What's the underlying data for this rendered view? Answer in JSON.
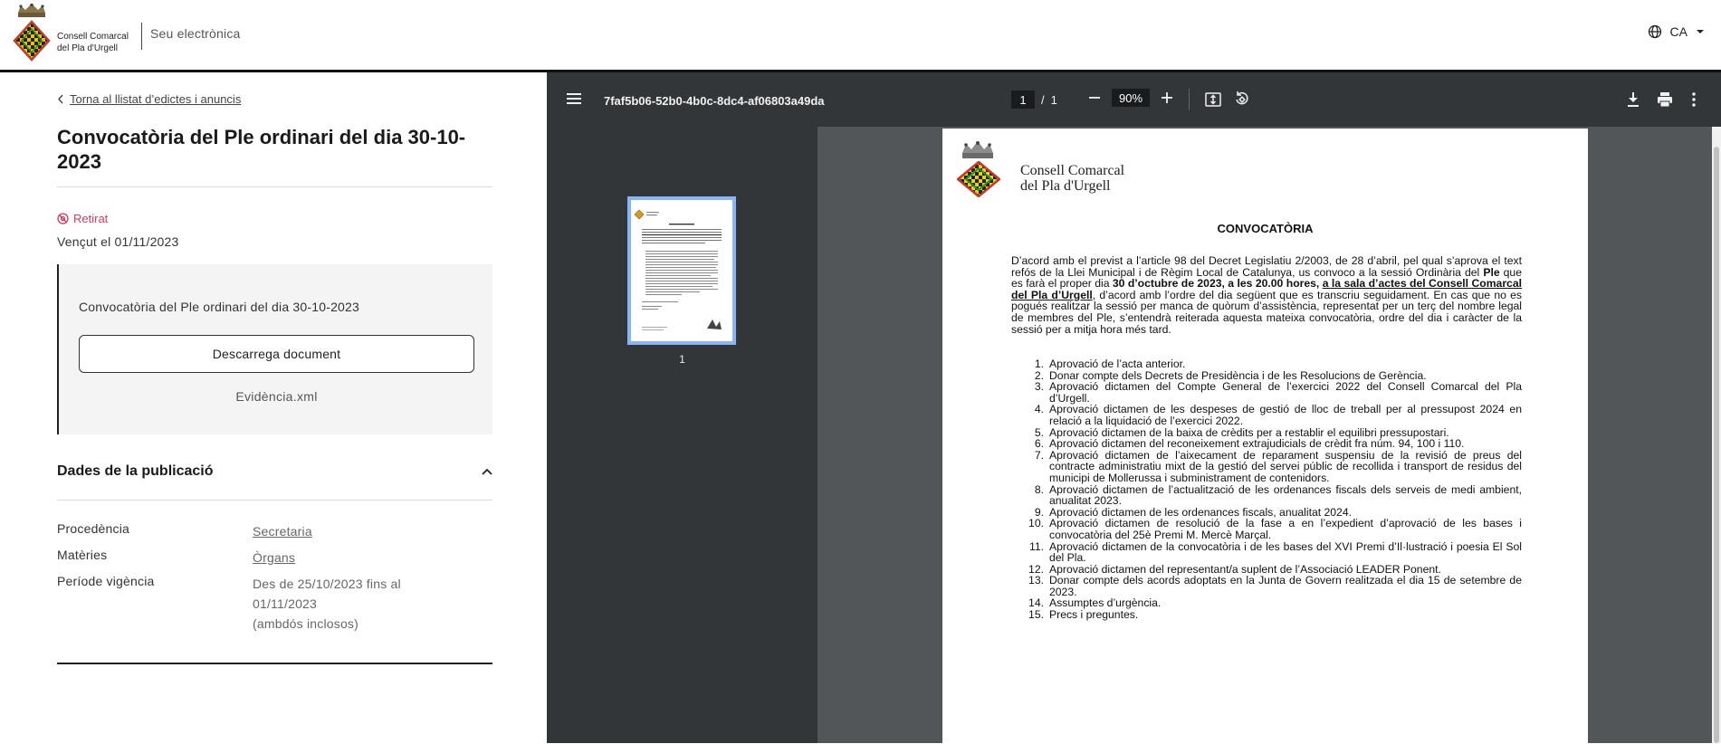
{
  "header": {
    "brand_line1": "Consell Comarcal",
    "brand_line2": "del Pla d'Urgell",
    "seu": "Seu electrònica",
    "language": "CA"
  },
  "left": {
    "back_link": "Torna al llistat d’edictes i anuncis",
    "title": "Convocatòria del Ple ordinari del dia 30-10-2023",
    "status": "Retirat",
    "expired": "Vençut el 01/11/2023",
    "document_box": {
      "title": "Convocatòria del Ple ordinari del dia 30-10-2023",
      "download_label": "Descarrega document",
      "evidence": "Evidència.xml"
    },
    "publication": {
      "heading": "Dades de la publicació",
      "rows": [
        {
          "label": "Procedència",
          "value": "Secretaria"
        },
        {
          "label": "Matèries",
          "value": "Òrgans"
        },
        {
          "label": "Període vigència",
          "value_line1": "Des de 25/10/2023 fins al",
          "value_line2": "01/11/2023",
          "value_line3": "(ambdós inclosos)"
        }
      ]
    }
  },
  "viewer": {
    "filename": "7faf5b06-52b0-4b0c-8dc4-af06803a49da",
    "page_current": "1",
    "page_total": "1",
    "zoom": "90%",
    "thumb_label": "1",
    "pdf": {
      "brand_line1": "Consell Comarcal",
      "brand_line2": "del Pla d'Urgell",
      "heading": "CONVOCATÒRIA",
      "para_part1": "D’acord amb el previst a l’article 98 del Decret Legislatiu 2/2003, de 28 d’abril, pel qual s’aprova el text refós de la Llei Municipal i de Règim Local de Catalunya, us convoco a la sessió Ordinària del ",
      "para_bold1": "Ple",
      "para_part2": " que es farà el proper dia ",
      "para_bold2": "30 d’octubre de 2023, a les 20.00 hores, ",
      "para_underline": "a la sala d’actes del Consell Comarcal del Pla d’Urgell",
      "para_part3": ", d’acord amb l’ordre del dia següent que es transcriu seguidament. En cas que no es pogués realitzar la sessió per manca de quòrum d’assistència, representat per un terç del nombre legal de membres del Ple, s’entendrà reiterada aquesta mateixa convocatòria, ordre del dia i caràcter de la sessió per a mitja hora més tard.",
      "items": [
        "Aprovació de l’acta anterior.",
        "Donar compte dels Decrets de Presidència i de les Resolucions de Gerència.",
        "Aprovació dictamen del Compte General de l’exercici 2022 del Consell Comarcal del Pla d’Urgell.",
        "Aprovació dictamen de les despeses de gestió de lloc de treball per al pressupost 2024 en relació a la liquidació de l’exercici 2022.",
        "Aprovació dictamen de la baixa de crèdits per a restablir el equilibri pressupostari.",
        "Aprovació dictamen del  reconeixement extrajudicials de crèdit fra núm. 94, 100 i 110.",
        "Aprovació dictamen de l’aixecament de reparament suspensiu de la revisió de preus del contracte administratiu mixt de la gestió del servei públic de recollida i transport de residus del municipi de Mollerussa i subministrament de contenidors.",
        "Aprovació dictamen de l’actualització de les ordenances fiscals dels serveis de medi ambient, anualitat 2023.",
        "Aprovació dictamen de les ordenances fiscals, anualitat 2024.",
        "Aprovació dictamen de resolució de la fase a en l’expedient d’aprovació de les bases i convocatòria del 25è Premi M. Mercè Marçal.",
        "Aprovació dictamen de la convocatòria i de les bases del XVI Premi d’Il·lustració i poesia El Sol del Pla.",
        "Aprovació dictamen del representant/a suplent de l’Associació LEADER Ponent.",
        "Donar compte dels acords adoptats en la Junta de Govern realitzada el dia 15 de setembre de 2023.",
        "Assumptes d’urgència.",
        "Precs i preguntes."
      ]
    }
  },
  "colors": {
    "status": "#d23b5c",
    "toolbar": "#323639",
    "viewer_bg": "#525659",
    "thumb_border": "#8ab4f8"
  },
  "icons": {
    "globe": "globe-icon",
    "caret": "caret-down-icon",
    "back": "chevron-left-icon",
    "status": "eye-off-icon",
    "collapse": "chevron-up-icon",
    "menu": "menu-icon",
    "zoom_out": "minus-icon",
    "zoom_in": "plus-icon",
    "fit": "fit-page-icon",
    "rotate": "rotate-icon",
    "download": "download-icon",
    "print": "print-icon",
    "more": "more-vert-icon"
  }
}
